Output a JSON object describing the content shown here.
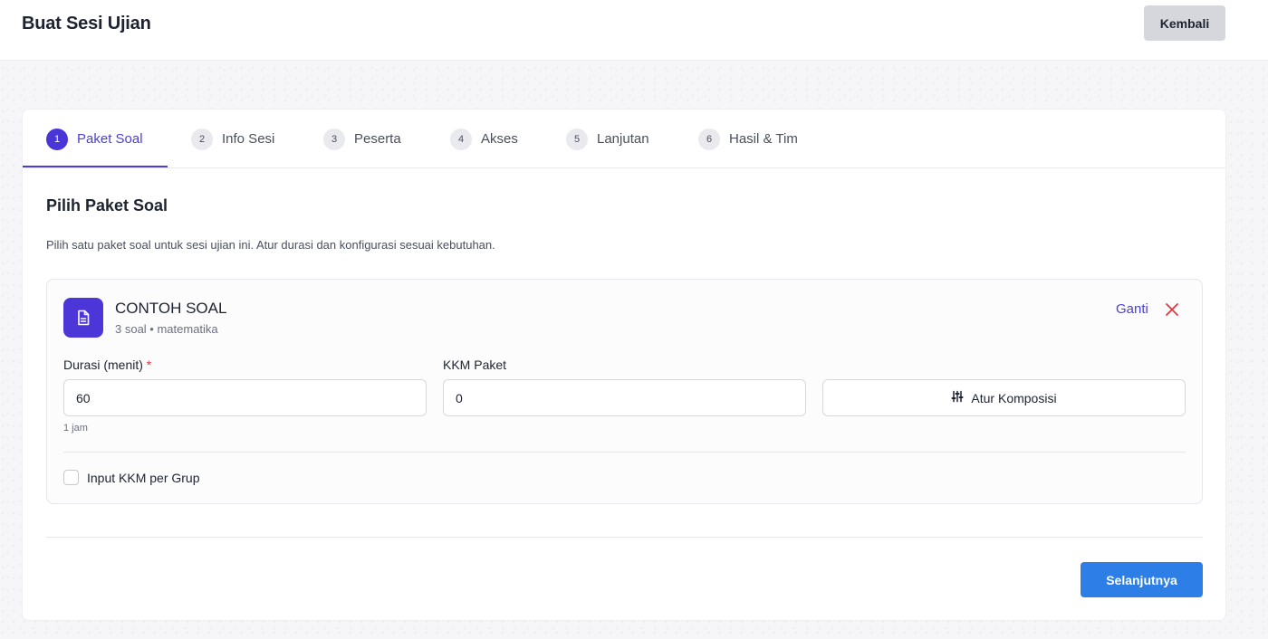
{
  "header": {
    "title": "Buat Sesi Ujian",
    "back_label": "Kembali"
  },
  "tabs": [
    {
      "num": "1",
      "label": "Paket Soal",
      "active": true
    },
    {
      "num": "2",
      "label": "Info Sesi",
      "active": false
    },
    {
      "num": "3",
      "label": "Peserta",
      "active": false
    },
    {
      "num": "4",
      "label": "Akses",
      "active": false
    },
    {
      "num": "5",
      "label": "Lanjutan",
      "active": false
    },
    {
      "num": "6",
      "label": "Hasil & Tim",
      "active": false
    }
  ],
  "section": {
    "title": "Pilih Paket Soal",
    "description": "Pilih satu paket soal untuk sesi ujian ini. Atur durasi dan konfigurasi sesuai kebutuhan."
  },
  "package": {
    "icon": "document-icon",
    "name": "CONTOH SOAL",
    "meta": "3 soal • matematika",
    "change_label": "Ganti",
    "remove_icon": "close-icon",
    "duration_label": "Durasi (menit)",
    "required_mark": "*",
    "duration_value": "60",
    "duration_hint": "1 jam",
    "kkm_label": "KKM Paket",
    "kkm_value": "0",
    "compose_icon": "sliders-icon",
    "compose_label": "Atur Komposisi",
    "group_kkm_label": "Input KKM per Grup",
    "group_kkm_checked": false
  },
  "footer": {
    "next_label": "Selanjutnya"
  },
  "colors": {
    "accent": "#4a3fd4",
    "primary_button": "#2d7ee6",
    "danger": "#e0383e",
    "neutral_button": "#d6d7dc"
  }
}
